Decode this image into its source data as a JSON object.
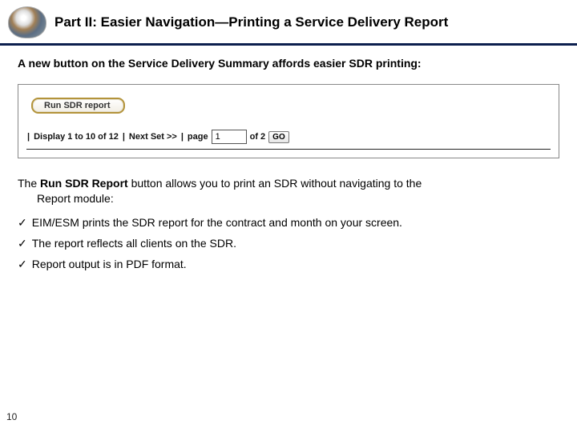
{
  "header": {
    "title": "Part II: Easier Navigation—Printing a Service Delivery Report"
  },
  "intro_text": "A new button on the Service Delivery Summary affords easier SDR printing:",
  "screenshot": {
    "run_button_label": "Run SDR report",
    "pager": {
      "display_text": "Display 1 to 10 of 12",
      "next_set_text": "Next Set >>",
      "page_label": "page",
      "page_value": "1",
      "of_text": "of 2",
      "go_label": "GO"
    }
  },
  "paragraph": {
    "before_bold": "The ",
    "bold": "Run SDR Report",
    "after_bold_line1": " button allows you to print an SDR without navigating to the",
    "line2": "Report module:"
  },
  "bullets": [
    "EIM/ESM prints the SDR report for the contract and month on your screen.",
    "The report reflects all clients on the SDR.",
    "Report output is in PDF format."
  ],
  "page_number": "10"
}
